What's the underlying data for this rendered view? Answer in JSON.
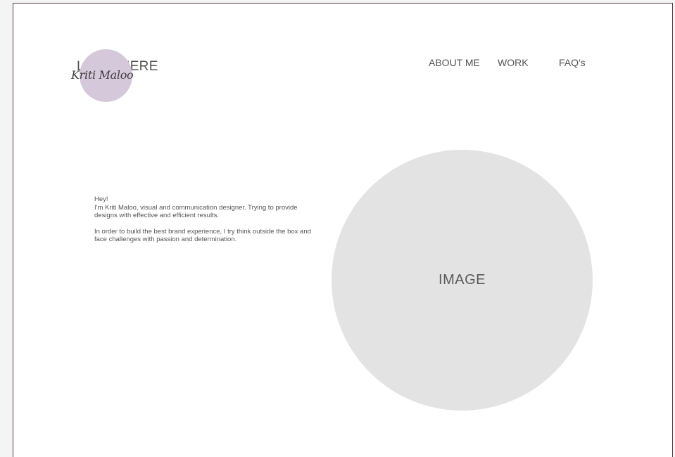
{
  "logo": {
    "placeholder_text": "LOGO HERE",
    "script_name": "Kriti Maloo"
  },
  "nav": {
    "items": [
      {
        "label": "ABOUT ME"
      },
      {
        "label": "WORK"
      },
      {
        "label": "FAQ's"
      }
    ]
  },
  "intro": {
    "greeting": "Hey!",
    "line1": "I'm Kriti Maloo, visual and communication designer. Trying to provide designs with effective and efficient results.",
    "line2": "In order to build the best brand experience, I try think outside the box and face challenges with passion and determination."
  },
  "hero": {
    "image_label": "IMAGE"
  },
  "colors": {
    "logo_circle": "#d6c8db",
    "image_placeholder": "#e3e3e3",
    "text": "#555555",
    "frame_border": "#5a3a44"
  }
}
